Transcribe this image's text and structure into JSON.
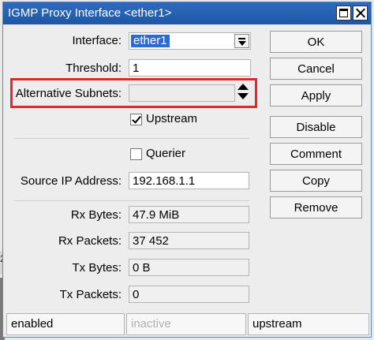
{
  "window": {
    "title": "IGMP Proxy Interface <ether1>"
  },
  "form": {
    "interface": {
      "label": "Interface:",
      "value": "ether1"
    },
    "threshold": {
      "label": "Threshold:",
      "value": "1"
    },
    "alt_subnets": {
      "label": "Alternative Subnets:",
      "value": ""
    },
    "upstream": {
      "label": "Upstream",
      "checked": true
    },
    "querier": {
      "label": "Querier",
      "checked": false
    },
    "source_ip": {
      "label": "Source IP Address:",
      "value": "192.168.1.1"
    },
    "rx_bytes": {
      "label": "Rx Bytes:",
      "value": "47.9 MiB"
    },
    "rx_packets": {
      "label": "Rx Packets:",
      "value": "37 452"
    },
    "tx_bytes": {
      "label": "Tx Bytes:",
      "value": "0 B"
    },
    "tx_packets": {
      "label": "Tx Packets:",
      "value": "0"
    }
  },
  "buttons": {
    "ok": "OK",
    "cancel": "Cancel",
    "apply": "Apply",
    "disable": "Disable",
    "comment": "Comment",
    "copy": "Copy",
    "remove": "Remove"
  },
  "status_bar": {
    "left": "enabled",
    "middle": "inactive",
    "right": "upstream"
  },
  "background": {
    "fragment_text": "2"
  },
  "colors": {
    "title_bar": "#2f6bbd",
    "highlight_border": "#e32630",
    "selection": "#2f6bcf"
  }
}
